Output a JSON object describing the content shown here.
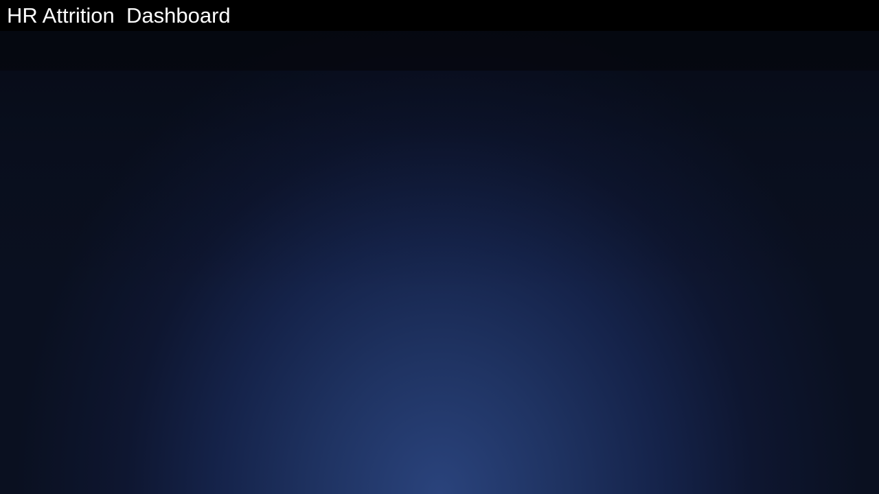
{
  "header": {
    "title": "HR Attrition  Dashboard"
  },
  "colors": {
    "title_bar": "#000000",
    "title_text": "#ffffff",
    "background_center": "#2a437c",
    "background_edge": "#0a1020",
    "filter_strip": "#05070e"
  }
}
